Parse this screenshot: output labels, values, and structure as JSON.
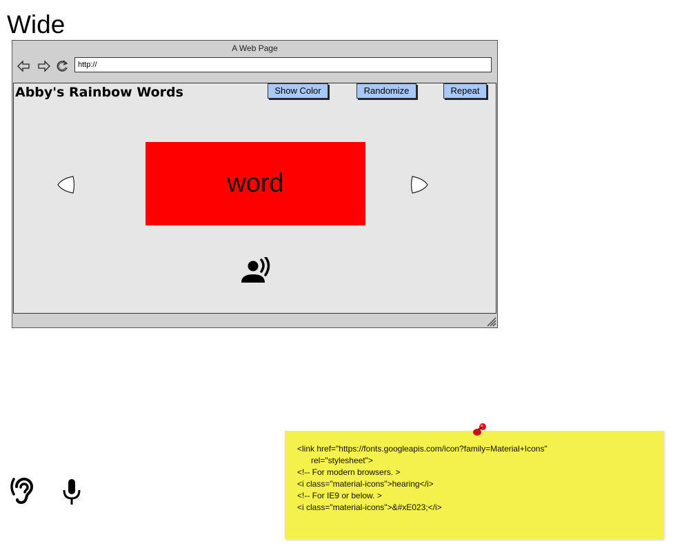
{
  "page": {
    "heading": "Wide"
  },
  "browser": {
    "window_title": "A Web Page",
    "url": "http://",
    "icons": [
      "back-arrow-icon",
      "forward-arrow-icon",
      "reload-icon",
      "resize-grip-icon"
    ]
  },
  "app": {
    "title": "Abby's Rainbow Words",
    "buttons": {
      "show_color": "Show Color",
      "randomize": "Randomize",
      "repeat": "Repeat"
    },
    "word": "word",
    "word_color": "#ff0000",
    "button_color": "#a8c8f8",
    "icons": [
      "previous-icon",
      "next-icon",
      "record-voice-over-icon"
    ]
  },
  "icons_row": [
    "hearing-icon",
    "microphone-icon"
  ],
  "sticky_note": {
    "color": "#f4f04c",
    "lines": [
      "<link href=\"https://fonts.googleapis.com/icon?family=Material+Icons\"",
      "      rel=\"stylesheet\">",
      "<!-- For modern browsers. >",
      "<i class=\"material-icons\">hearing</i>",
      "<!-- For IE9 or below. >",
      "<i class=\"material-icons\">&#xE023;</i>"
    ]
  }
}
